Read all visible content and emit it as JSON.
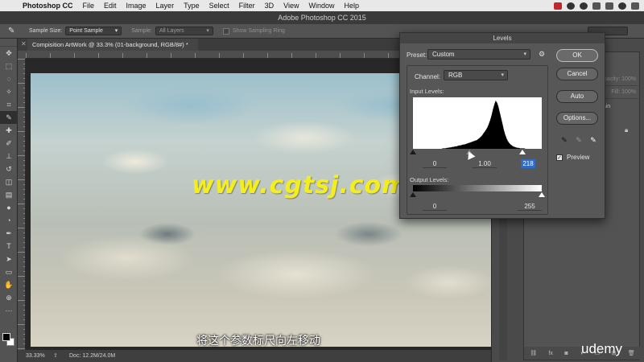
{
  "menubar": {
    "app_name": "Photoshop CC",
    "items": [
      "File",
      "Edit",
      "Image",
      "Layer",
      "Type",
      "Select",
      "Filter",
      "3D",
      "View",
      "Window",
      "Help"
    ]
  },
  "window": {
    "title": "Adobe Photoshop CC 2015"
  },
  "options_bar": {
    "sample_size_label": "Sample Size:",
    "sample_size_value": "Point Sample",
    "sample_label": "Sample:",
    "sample_value": "All Layers",
    "show_sampling_ring": "Show Sampling Ring"
  },
  "document": {
    "tab_title": "Compisition ArtWork @ 33.3% (01-background, RGB/8#) *",
    "watermark": "www.cgtsj.com",
    "subtitle": "将这个参数标尺向左移动"
  },
  "status": {
    "zoom": "33.33%",
    "doc": "Doc: 12.2M/24.0M"
  },
  "levels_dialog": {
    "title": "Levels",
    "preset_label": "Preset:",
    "preset_value": "Custom",
    "channel_label": "Channel:",
    "channel_value": "RGB",
    "input_label": "Input Levels:",
    "input_values": {
      "black": "0",
      "gamma": "1.00",
      "white": "218"
    },
    "output_label": "Output Levels:",
    "output_values": {
      "black": "0",
      "white": "255"
    },
    "buttons": {
      "ok": "OK",
      "cancel": "Cancel",
      "auto": "Auto",
      "options": "Options..."
    },
    "preview_label": "Preview",
    "preview_checked": true,
    "histogram": [
      0,
      0,
      0,
      0,
      0,
      0,
      0,
      0,
      0,
      0,
      0,
      0,
      0,
      0,
      0,
      0,
      0,
      0,
      0,
      0,
      0,
      0,
      1,
      1,
      1,
      2,
      2,
      3,
      3,
      4,
      4,
      5,
      5,
      6,
      7,
      7,
      8,
      9,
      9,
      10,
      11,
      12,
      13,
      14,
      15,
      16,
      17,
      18,
      20,
      22,
      25,
      28,
      32,
      36,
      40,
      45,
      52,
      60,
      70,
      82,
      92,
      100,
      96,
      88,
      76,
      64,
      52,
      40,
      30,
      22,
      16,
      12,
      9,
      7,
      5,
      4,
      3,
      2,
      2,
      1,
      1,
      1,
      1,
      0,
      0,
      0,
      0,
      0,
      0,
      0,
      0,
      0,
      0,
      0,
      0,
      0
    ]
  },
  "layers_panel": {
    "opacity_label": "Opacity: 100%",
    "fill_label": "Fill: 100%",
    "layer_name": "ntain"
  },
  "branding": {
    "udemy": "udemy"
  },
  "colors": {
    "accent_highlight": "#2f6cc4",
    "watermark": "#f4ee1e",
    "panel_bg": "#535353"
  }
}
